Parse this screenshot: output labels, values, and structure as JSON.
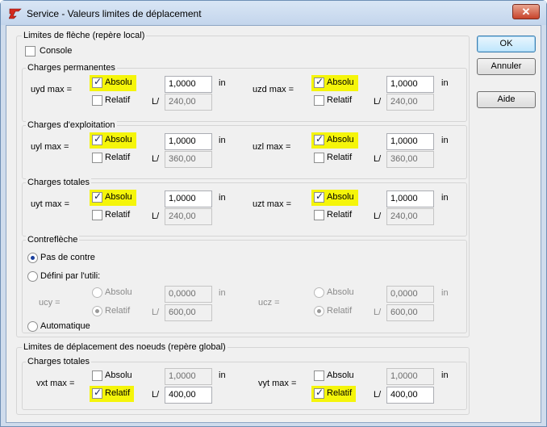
{
  "window": {
    "title": "Service - Valeurs limites de déplacement",
    "close": "✕"
  },
  "buttons": {
    "ok": "OK",
    "cancel": "Annuler",
    "help": "Aide"
  },
  "fleche": {
    "title": "Limites de flèche (repère local)",
    "console_label": "Console",
    "console_checked": false,
    "perm": {
      "title": "Charges permanentes",
      "left": {
        "label": "uyd max =",
        "absolu": "Absolu",
        "relatif": "Relatif",
        "value": "1,0000",
        "unit": "in",
        "l": "L/",
        "lvalue": "240,00"
      },
      "right": {
        "label": "uzd max =",
        "absolu": "Absolu",
        "relatif": "Relatif",
        "value": "1,0000",
        "unit": "in",
        "l": "L/",
        "lvalue": "240,00"
      }
    },
    "expl": {
      "title": "Charges d'exploitation",
      "left": {
        "label": "uyl max =",
        "absolu": "Absolu",
        "relatif": "Relatif",
        "value": "1,0000",
        "unit": "in",
        "l": "L/",
        "lvalue": "360,00"
      },
      "right": {
        "label": "uzl max =",
        "absolu": "Absolu",
        "relatif": "Relatif",
        "value": "1,0000",
        "unit": "in",
        "l": "L/",
        "lvalue": "360,00"
      }
    },
    "tot": {
      "title": "Charges totales",
      "left": {
        "label": "uyt max =",
        "absolu": "Absolu",
        "relatif": "Relatif",
        "value": "1,0000",
        "unit": "in",
        "l": "L/",
        "lvalue": "240,00"
      },
      "right": {
        "label": "uzt max =",
        "absolu": "Absolu",
        "relatif": "Relatif",
        "value": "1,0000",
        "unit": "in",
        "l": "L/",
        "lvalue": "240,00"
      }
    },
    "contre": {
      "title": "Contreflèche",
      "opt_none": "Pas de contre",
      "opt_user": "Défini par l'utili:",
      "opt_auto": "Automatique",
      "left": {
        "label": "ucy =",
        "absolu": "Absolu",
        "relatif": "Relatif",
        "value": "0,0000",
        "unit": "in",
        "l": "L/",
        "lvalue": "600,00"
      },
      "right": {
        "label": "ucz =",
        "absolu": "Absolu",
        "relatif": "Relatif",
        "value": "0,0000",
        "unit": "in",
        "l": "L/",
        "lvalue": "600,00"
      }
    }
  },
  "noeuds": {
    "title": "Limites de déplacement des noeuds (repère global)",
    "tot": {
      "title": "Charges totales",
      "left": {
        "label": "vxt max =",
        "absolu": "Absolu",
        "relatif": "Relatif",
        "value": "1,0000",
        "unit": "in",
        "l": "L/",
        "lvalue": "400,00"
      },
      "right": {
        "label": "vyt max =",
        "absolu": "Absolu",
        "relatif": "Relatif",
        "value": "1,0000",
        "unit": "in",
        "l": "L/",
        "lvalue": "400,00"
      }
    }
  },
  "colors": {
    "highlight": "#f5f50a",
    "accent": "#1a3f9c"
  }
}
